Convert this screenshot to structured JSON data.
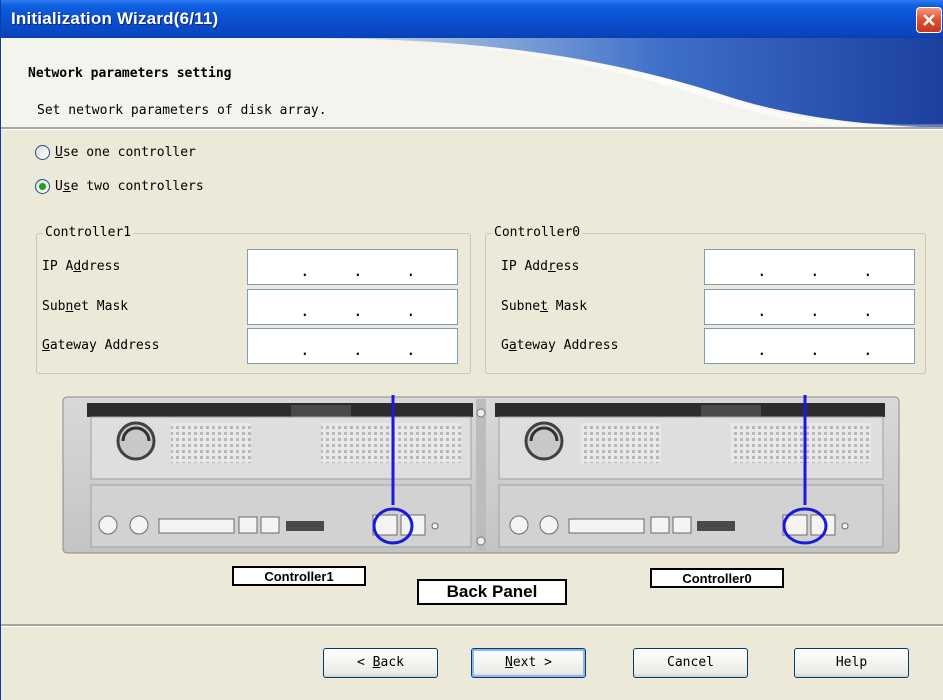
{
  "window": {
    "title": "Initialization Wizard(6/11)"
  },
  "header": {
    "title": "Network parameters setting",
    "subtitle": "Set network parameters of disk array."
  },
  "options": {
    "one_controller": {
      "label_pre": "",
      "label_accel": "U",
      "label_post": "se one controller",
      "selected": false
    },
    "two_controllers": {
      "label_pre": "U",
      "label_accel": "s",
      "label_post": "e two controllers",
      "selected": true
    }
  },
  "controller1": {
    "legend": "Controller1",
    "ip_label_pre": "IP A",
    "ip_label_accel": "d",
    "ip_label_post": "dress",
    "subnet_label_pre": "Sub",
    "subnet_label_accel": "n",
    "subnet_label_post": "et Mask",
    "gateway_label_pre": "",
    "gateway_label_accel": "G",
    "gateway_label_post": "ateway Address"
  },
  "controller0": {
    "legend": "Controller0",
    "ip_label_pre": "IP Add",
    "ip_label_accel": "r",
    "ip_label_post": "ess",
    "subnet_label_pre": "Subne",
    "subnet_label_accel": "t",
    "subnet_label_post": " Mask",
    "gateway_label_pre": "G",
    "gateway_label_accel": "a",
    "gateway_label_post": "teway Address"
  },
  "figure": {
    "label_controller1": "Controller1",
    "label_controller0": "Controller0",
    "label_back_panel": "Back Panel",
    "highlight_color": "#1a1adc"
  },
  "buttons": {
    "back_pre": "< ",
    "back_accel": "B",
    "back_post": "ack",
    "next_pre": "",
    "next_accel": "N",
    "next_post": "ext >",
    "cancel": "Cancel",
    "help": "Help"
  },
  "colors": {
    "title_bar": "#0b4fd0",
    "close_button": "#e1532f",
    "window_bg": "#ece9d8"
  }
}
